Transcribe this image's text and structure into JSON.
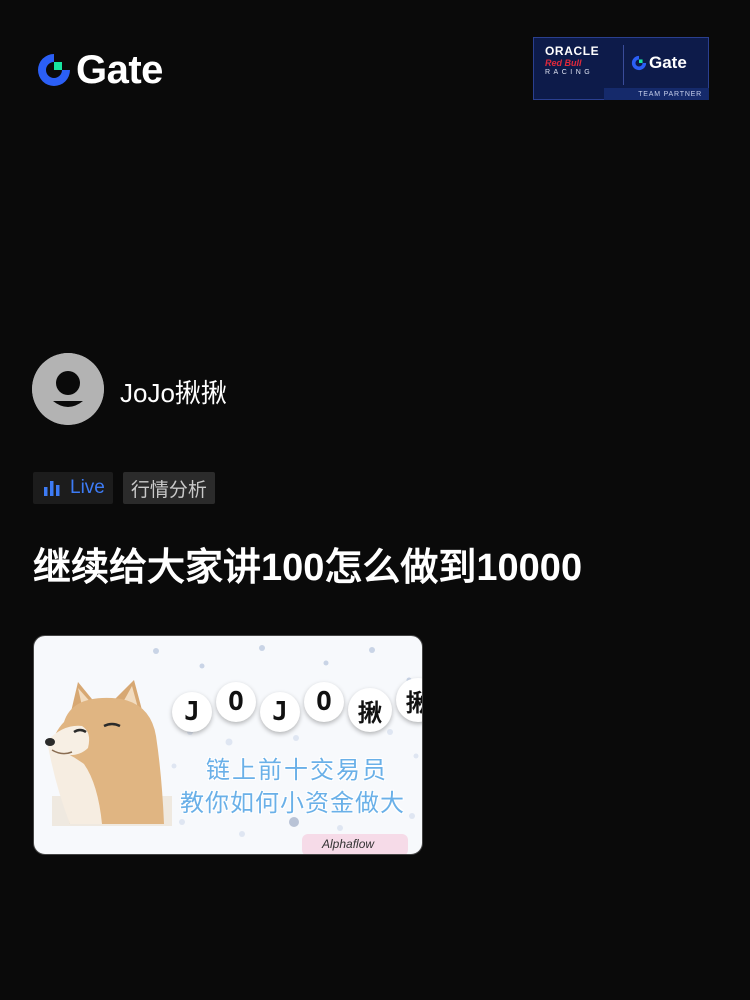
{
  "header": {
    "brand": "Gate",
    "partner": {
      "oracle": "ORACLE",
      "redbull": "Red Bull",
      "racing": "RACING",
      "brand": "Gate",
      "team_partner": "TEAM PARTNER"
    }
  },
  "author": {
    "name": "JoJo揪揪",
    "avatar_icon": "default-user-icon"
  },
  "tags": {
    "live": "Live",
    "category": "行情分析"
  },
  "post": {
    "title": "继续给大家讲100怎么做到10000",
    "thumbnail": {
      "letters": [
        "J",
        "O",
        "J",
        "O",
        "揪",
        "揪"
      ],
      "line1": "链上前十交易员",
      "line2": "教你如何小资金做大",
      "signature": "Alphaflow"
    }
  },
  "colors": {
    "background": "#0a0a0a",
    "accent": "#3d7bf5",
    "brand_green": "#17e5a1"
  }
}
